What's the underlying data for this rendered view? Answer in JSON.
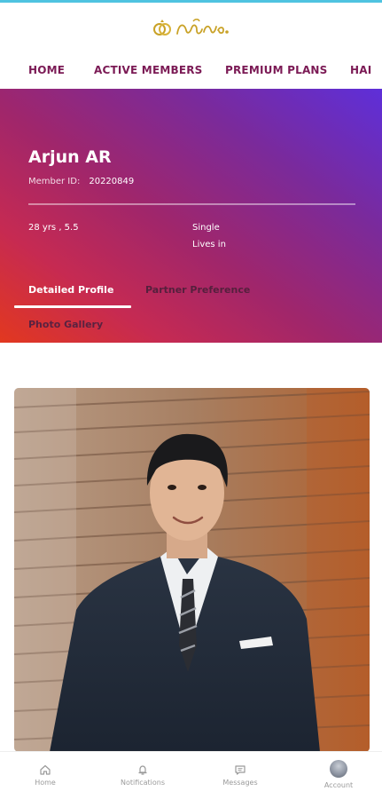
{
  "app": {
    "logo_alt": "matrimony logo",
    "accent_color": "#4fc3e0",
    "brand_color": "#7b1a55"
  },
  "nav": {
    "items": [
      {
        "label": "HOME"
      },
      {
        "label": "ACTIVE MEMBERS"
      },
      {
        "label": "PREMIUM PLANS"
      },
      {
        "label": "HAI"
      }
    ]
  },
  "profile": {
    "name": "Arjun AR",
    "member_id_label": "Member ID:",
    "member_id": "20220849",
    "age_height": "28 yrs , 5.5",
    "marital_status": "Single",
    "lives_in_label": "Lives in",
    "gradient_colors": [
      "#e2381f",
      "#a0266b",
      "#5e2fd9"
    ]
  },
  "tabs": {
    "detailed_profile": "Detailed Profile",
    "partner_preference": "Partner Preference",
    "photo_gallery": "Photo Gallery"
  },
  "bottom_nav": {
    "home": "Home",
    "notifications": "Notifications",
    "messages": "Messages",
    "account": "Account"
  }
}
